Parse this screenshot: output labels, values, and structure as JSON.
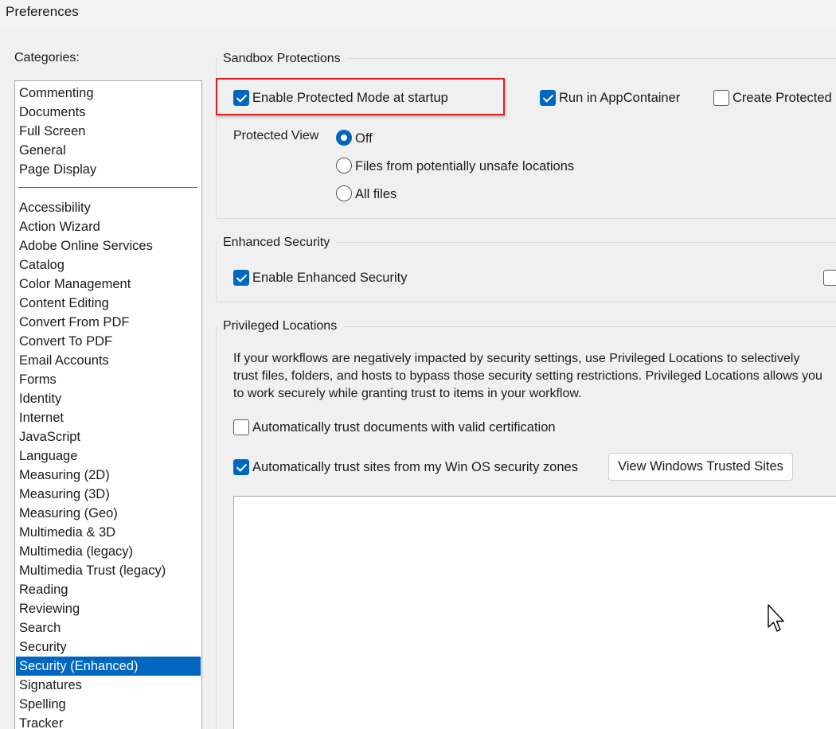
{
  "window": {
    "title": "Preferences"
  },
  "categories": {
    "label": "Categories:",
    "top_items": [
      "Commenting",
      "Documents",
      "Full Screen",
      "General",
      "Page Display"
    ],
    "items": [
      "Accessibility",
      "Action Wizard",
      "Adobe Online Services",
      "Catalog",
      "Color Management",
      "Content Editing",
      "Convert From PDF",
      "Convert To PDF",
      "Email Accounts",
      "Forms",
      "Identity",
      "Internet",
      "JavaScript",
      "Language",
      "Measuring (2D)",
      "Measuring (3D)",
      "Measuring (Geo)",
      "Multimedia & 3D",
      "Multimedia (legacy)",
      "Multimedia Trust (legacy)",
      "Reading",
      "Reviewing",
      "Search",
      "Security",
      "Security (Enhanced)",
      "Signatures",
      "Spelling",
      "Tracker"
    ],
    "selected": "Security (Enhanced)"
  },
  "sandbox": {
    "title": "Sandbox Protections",
    "protected_mode": {
      "label": "Enable Protected Mode at startup",
      "checked": true
    },
    "app_container": {
      "label": "Run in AppContainer",
      "checked": true
    },
    "create_protected": {
      "label": "Create Protected M",
      "checked": false
    },
    "protected_view": {
      "label": "Protected View",
      "options": [
        {
          "label": "Off",
          "selected": true
        },
        {
          "label": "Files from potentially unsafe locations",
          "selected": false
        },
        {
          "label": "All files",
          "selected": false
        }
      ]
    }
  },
  "enhanced": {
    "title": "Enhanced Security",
    "enable": {
      "label": "Enable Enhanced Security",
      "checked": true
    },
    "extra_checkbox_checked": false
  },
  "privileged": {
    "title": "Privileged Locations",
    "description": "If your workflows are negatively impacted by security settings, use Privileged Locations to selectively trust files, folders, and hosts to bypass those security setting restrictions. Privileged Locations allows you to work securely while granting trust to items in your workflow.",
    "trust_certified": {
      "label": "Automatically trust documents with valid certification",
      "checked": false
    },
    "trust_sites": {
      "label": "Automatically trust sites from my Win OS security zones",
      "checked": true
    },
    "view_sites_button": "View Windows Trusted Sites"
  },
  "colors": {
    "accent": "#0067c0",
    "highlight_border": "#e02020",
    "window_bg": "#f0f0f0"
  },
  "icons": {
    "checkbox": "checkbox-icon",
    "radio": "radio-icon",
    "cursor": "mouse-pointer-icon"
  }
}
